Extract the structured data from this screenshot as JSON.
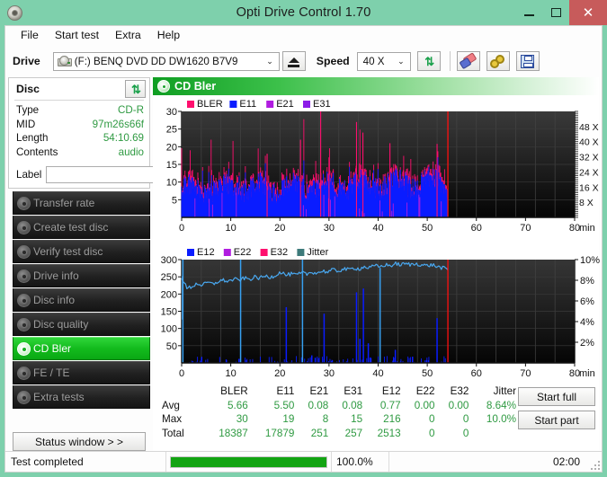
{
  "window": {
    "title": "Opti Drive Control 1.70",
    "icon": "cd-disc-icon",
    "minimize": "minimize-icon",
    "maximize": "maximize-icon",
    "close": "✕"
  },
  "menu": {
    "items": [
      "File",
      "Start test",
      "Extra",
      "Help"
    ]
  },
  "toolbar": {
    "drive_label": "Drive",
    "drive_value": "(F:)   BENQ DVD DD DW1620 B7V9",
    "drive_icon": "drive-icon",
    "eject_label": "eject-icon",
    "speed_label": "Speed",
    "speed_value": "40 X",
    "refresh_icon": "refresh-icon",
    "eraser_icon": "eraser-icon",
    "gears_icon": "gears-icon",
    "save_icon": "floppy-save-icon",
    "dropdown_arrow": "⌄"
  },
  "disc_panel": {
    "title": "Disc",
    "refresh_icon": "refresh-icon",
    "rows": [
      {
        "key": "Type",
        "value": "CD-R"
      },
      {
        "key": "MID",
        "value": "97m26s66f"
      },
      {
        "key": "Length",
        "value": "54:10.69"
      },
      {
        "key": "Contents",
        "value": "audio"
      }
    ],
    "label_key": "Label",
    "label_value": "",
    "label_placeholder": "",
    "disc_button_icon": "cd-disc-icon"
  },
  "nav": {
    "items": [
      {
        "label": "Transfer rate",
        "active": false
      },
      {
        "label": "Create test disc",
        "active": false
      },
      {
        "label": "Verify test disc",
        "active": false
      },
      {
        "label": "Drive info",
        "active": false
      },
      {
        "label": "Disc info",
        "active": false
      },
      {
        "label": "Disc quality",
        "active": false
      },
      {
        "label": "CD Bler",
        "active": true
      },
      {
        "label": "FE / TE",
        "active": false
      },
      {
        "label": "Extra tests",
        "active": false
      }
    ],
    "status_window": "Status window > >"
  },
  "panel": {
    "title": "CD Bler",
    "icon": "cd-disc-icon"
  },
  "actions": {
    "start_full": "Start full",
    "start_part": "Start part"
  },
  "statusbar": {
    "message": "Test completed",
    "progress_percent": 100.0,
    "progress_text": "100.0%",
    "elapsed": "02:00"
  },
  "stats": {
    "columns": [
      "BLER",
      "E11",
      "E21",
      "E31",
      "E12",
      "E22",
      "E32",
      "Jitter"
    ],
    "rows": [
      {
        "name": "Avg",
        "values": [
          "5.66",
          "5.50",
          "0.08",
          "0.08",
          "0.77",
          "0.00",
          "0.00",
          "8.64%"
        ]
      },
      {
        "name": "Max",
        "values": [
          "30",
          "19",
          "8",
          "15",
          "216",
          "0",
          "0",
          "10.0%"
        ]
      },
      {
        "name": "Total",
        "values": [
          "18387",
          "17879",
          "251",
          "257",
          "2513",
          "0",
          "0",
          ""
        ]
      }
    ]
  },
  "colors": {
    "bler": "#ff0f6e",
    "e11": "#0a1cff",
    "e21": "#b01ce0",
    "e31": "#8c1ce8",
    "e12": "#0a1cff",
    "e22": "#b01ce0",
    "e32": "#ff0f6e",
    "jitter": "#3d7a7a",
    "jitter_line": "#49a8f0",
    "speed_line": "#ff1010",
    "accent_green": "#13bb1d",
    "title_bg": "#7ed0ac",
    "close_bg": "#c75b5b"
  },
  "chart_data": [
    {
      "type": "line",
      "name": "CD Bler upper",
      "title": "CD Bler",
      "legend": [
        {
          "label": "BLER",
          "color": "#ff0f6e"
        },
        {
          "label": "E11",
          "color": "#0a1cff"
        },
        {
          "label": "E21",
          "color": "#b01ce0"
        },
        {
          "label": "E31",
          "color": "#8c1ce8"
        }
      ],
      "legend_position": "top-left",
      "grid": true,
      "xlabel": "min",
      "xlim": [
        0,
        80
      ],
      "xticks": [
        0,
        10,
        20,
        30,
        40,
        50,
        60,
        70,
        80
      ],
      "ylabel": "",
      "ylim": [
        0,
        30
      ],
      "yticks": [
        5,
        10,
        15,
        20,
        25,
        30
      ],
      "y2label": "",
      "y2lim": [
        0,
        52
      ],
      "y2ticks": [
        "8 X",
        "16 X",
        "24 X",
        "32 X",
        "40 X",
        "48 X"
      ],
      "data_end_min": 54.2,
      "series": [
        {
          "name": "BLER",
          "color": "#ff0f6e",
          "avg": 5.66,
          "max": 30,
          "total": 18387
        },
        {
          "name": "E11",
          "color": "#0a1cff",
          "avg": 5.5,
          "max": 19,
          "total": 17879
        },
        {
          "name": "E21",
          "color": "#b01ce0",
          "avg": 0.08,
          "max": 8,
          "total": 251
        },
        {
          "name": "E31",
          "color": "#8c1ce8",
          "avg": 0.08,
          "max": 15,
          "total": 257
        }
      ],
      "notes": "Dense BLER/E11 error band 0-54 min, baseline ~5-15, peaks to 30 at 28 and 54 min."
    },
    {
      "type": "line",
      "name": "CD Bler lower",
      "legend": [
        {
          "label": "E12",
          "color": "#0a1cff"
        },
        {
          "label": "E22",
          "color": "#b01ce0"
        },
        {
          "label": "E32",
          "color": "#ff0f6e"
        },
        {
          "label": "Jitter",
          "color": "#3d7a7a"
        }
      ],
      "legend_position": "top-left",
      "grid": true,
      "xlabel": "min",
      "xlim": [
        0,
        80
      ],
      "xticks": [
        0,
        10,
        20,
        30,
        40,
        50,
        60,
        70,
        80
      ],
      "ylabel": "",
      "ylim": [
        0,
        300
      ],
      "yticks": [
        50,
        100,
        150,
        200,
        250,
        300
      ],
      "y2label": "",
      "y2lim": [
        0,
        10
      ],
      "y2ticks": [
        "2%",
        "4%",
        "6%",
        "8%",
        "10%"
      ],
      "data_end_min": 54.2,
      "series": [
        {
          "name": "E12",
          "color": "#0a1cff",
          "avg": 0.77,
          "max": 216,
          "total": 2513
        },
        {
          "name": "E22",
          "color": "#b01ce0",
          "avg": 0.0,
          "max": 0,
          "total": 0
        },
        {
          "name": "E32",
          "color": "#ff0f6e",
          "avg": 0.0,
          "max": 0,
          "total": 0
        },
        {
          "name": "Jitter",
          "color": "#49a8f0",
          "avg": "8.64%",
          "max": "10.0%",
          "total": ""
        }
      ],
      "jitter_trace_percent": [
        8.3,
        7.2,
        7.4,
        7.7,
        7.5,
        7.8,
        7.6,
        7.9,
        8.0,
        7.9,
        8.1,
        8.0,
        8.2,
        8.1,
        8.3,
        8.2,
        8.4,
        8.3,
        8.5,
        8.8,
        8.5,
        8.6,
        8.5,
        8.7,
        8.6,
        8.8,
        8.7,
        8.9,
        8.8,
        9.0,
        8.9,
        9.1,
        9.0,
        9.2,
        9.1,
        9.3,
        9.2,
        9.4,
        9.3,
        9.5,
        9.4,
        9.6,
        9.5,
        9.6,
        9.5,
        9.6,
        9.5,
        9.4,
        9.5,
        9.3,
        9.2,
        9.0
      ],
      "e12_spikes_min": [
        0.2,
        12.0,
        21.3,
        24.6,
        29.0,
        35.6,
        37.0,
        40.4,
        43.5,
        52.0
      ],
      "notes": "Jitter trace rises from ~7.2% to ~9.6%; E12 spikes up to 216 at several positions."
    }
  ]
}
